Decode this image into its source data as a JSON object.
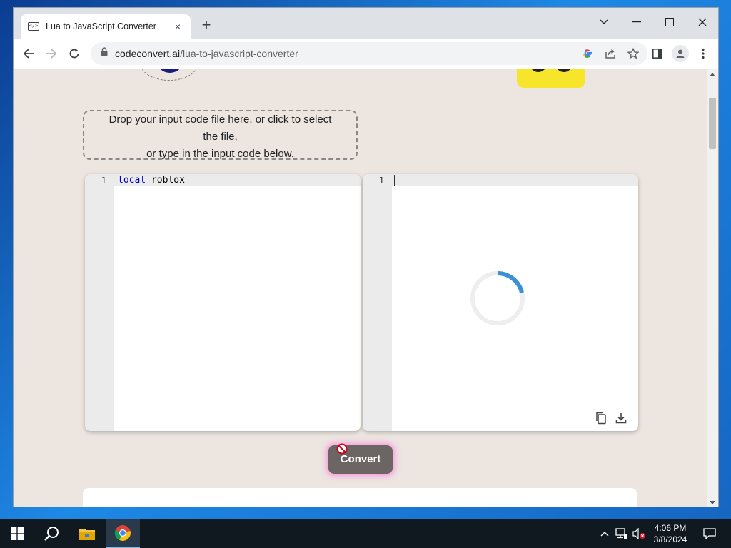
{
  "browser": {
    "tab_title": "Lua to JavaScript Converter",
    "tab_favicon_glyph": "</>",
    "url_domain": "codeconvert.ai",
    "url_path": "/lua-to-javascript-converter",
    "new_tab_symbol": "+",
    "close_tab_symbol": "×"
  },
  "page": {
    "dropzone_line1": "Drop your input code file here, or click to select",
    "dropzone_line2": "the file,",
    "dropzone_line3": "or type in the input code below.",
    "input_editor": {
      "line_number": "1",
      "code_keyword": "local",
      "code_rest": " roblox"
    },
    "output_editor": {
      "line_number": "1",
      "loading": true
    },
    "convert_label": "Convert"
  },
  "taskbar": {
    "time": "4:06 PM",
    "date": "3/8/2024"
  },
  "colors": {
    "page_bg": "#ece5e0",
    "spinner_accent": "#3a8fd6",
    "convert_bg": "#6b6563"
  }
}
